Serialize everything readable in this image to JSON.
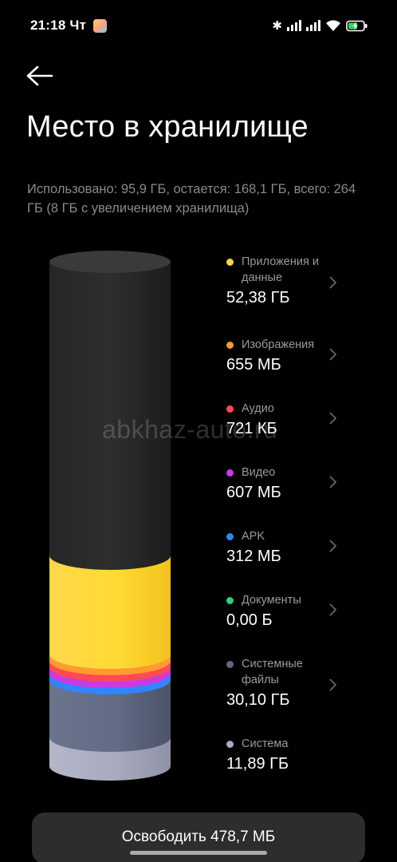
{
  "status_bar": {
    "time": "21:18",
    "day": "Чт",
    "icons": [
      "bluetooth-icon",
      "signal-icon",
      "signal-icon",
      "wifi-icon",
      "battery-charging-icon"
    ]
  },
  "header": {
    "back_icon": "arrow-left-icon",
    "title": "Место в хранилище"
  },
  "summary": "Использовано: 95,9 ГБ, остается: 168,1 ГБ, всего: 264 ГБ (8 ГБ с увеличением хранилища)",
  "categories": [
    {
      "label": "Приложения и данные",
      "size": "52,38 ГБ",
      "color": "#ffd23f",
      "has_chevron": true
    },
    {
      "label": "Изображения",
      "size": "655 МБ",
      "color": "#ff9b2f",
      "has_chevron": true
    },
    {
      "label": "Аудио",
      "size": "721 КБ",
      "color": "#ff4a55",
      "has_chevron": true
    },
    {
      "label": "Видео",
      "size": "607 МБ",
      "color": "#c93be0",
      "has_chevron": true
    },
    {
      "label": "APK",
      "size": "312 МБ",
      "color": "#2f86ff",
      "has_chevron": true
    },
    {
      "label": "Документы",
      "size": "0,00 Б",
      "color": "#2fd07a",
      "has_chevron": true
    },
    {
      "label": "Системные файлы",
      "size": "30,10 ГБ",
      "color": "#5e6782",
      "has_chevron": true
    },
    {
      "label": "Система",
      "size": "11,89 ГБ",
      "color": "#a9abc0",
      "has_chevron": false
    }
  ],
  "watermark": "abkhaz-auto.ru",
  "free_button": {
    "label": "Освободить 478,7 МБ"
  }
}
